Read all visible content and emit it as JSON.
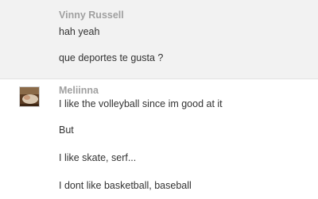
{
  "messages": [
    {
      "author": "Vinny Russell",
      "lines": [
        "hah yeah",
        "que deportes te gusta ?"
      ]
    },
    {
      "author": "Meliinna",
      "lines": [
        "I like the volleyball since im good at it",
        "But",
        "I like skate, serf...",
        "I dont like basketball, baseball"
      ]
    }
  ],
  "colors": {
    "author_name": "#a0a0a0",
    "message_text": "#333333",
    "alt_row_background": "#f2f2f2"
  }
}
